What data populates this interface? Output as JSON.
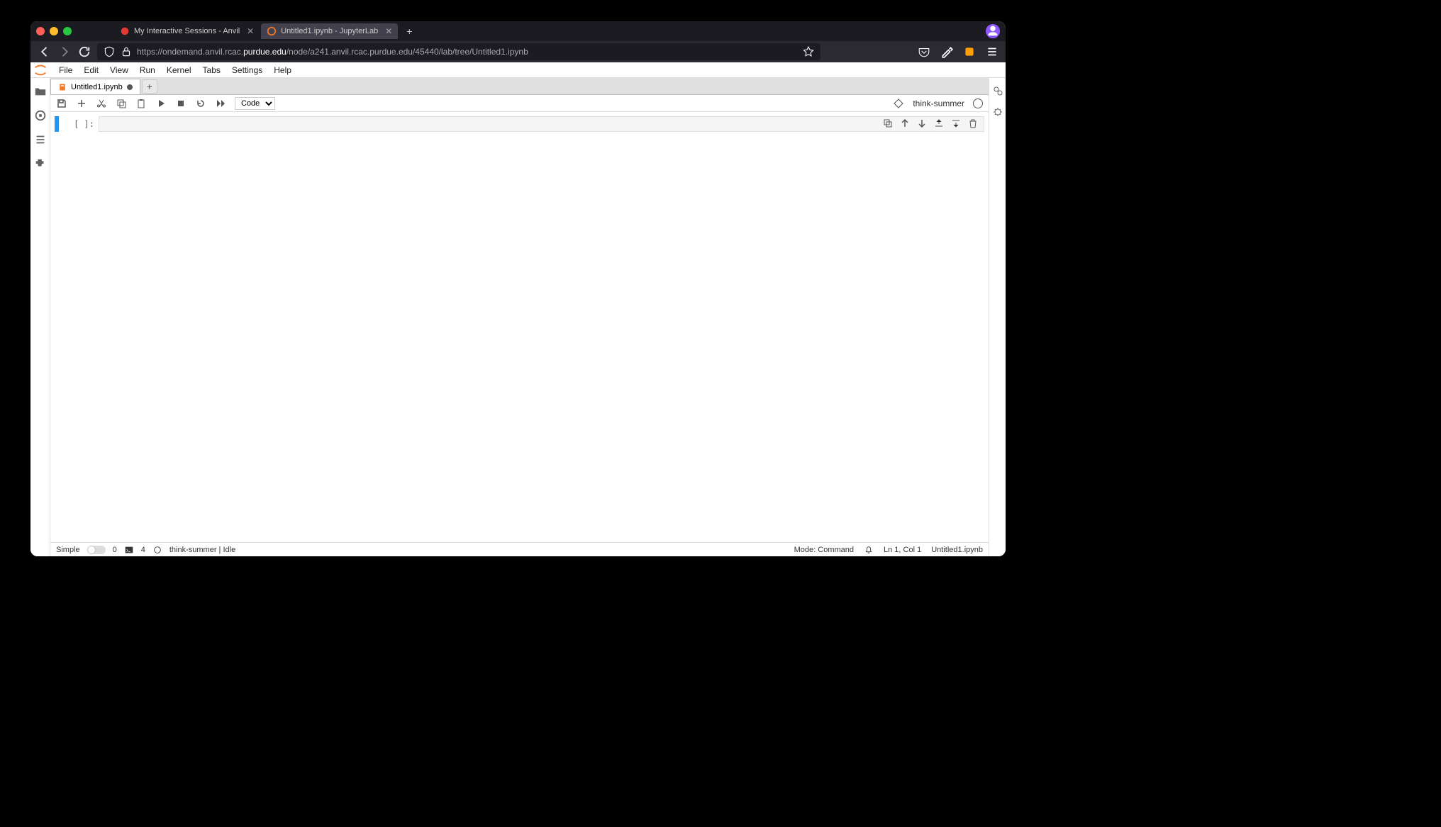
{
  "browser": {
    "tabs": [
      {
        "title": "My Interactive Sessions - Anvil"
      },
      {
        "title": "Untitled1.ipynb - JupyterLab"
      }
    ],
    "url_pre": "https://ondemand.anvil.rcac.",
    "url_domain": "purdue.edu",
    "url_post": "/node/a241.anvil.rcac.purdue.edu/45440/lab/tree/Untitled1.ipynb"
  },
  "menubar": [
    "File",
    "Edit",
    "View",
    "Run",
    "Kernel",
    "Tabs",
    "Settings",
    "Help"
  ],
  "notebook_tab": "Untitled1.ipynb",
  "toolbar": {
    "cell_type": "Code",
    "kernel_name": "think-summer"
  },
  "cell": {
    "prompt": "[ ]:"
  },
  "status": {
    "simple": "Simple",
    "terminals": "0",
    "consoles": "4",
    "kernel": "think-summer | Idle",
    "mode": "Mode: Command",
    "ln": "Ln 1, Col 1",
    "file": "Untitled1.ipynb"
  }
}
